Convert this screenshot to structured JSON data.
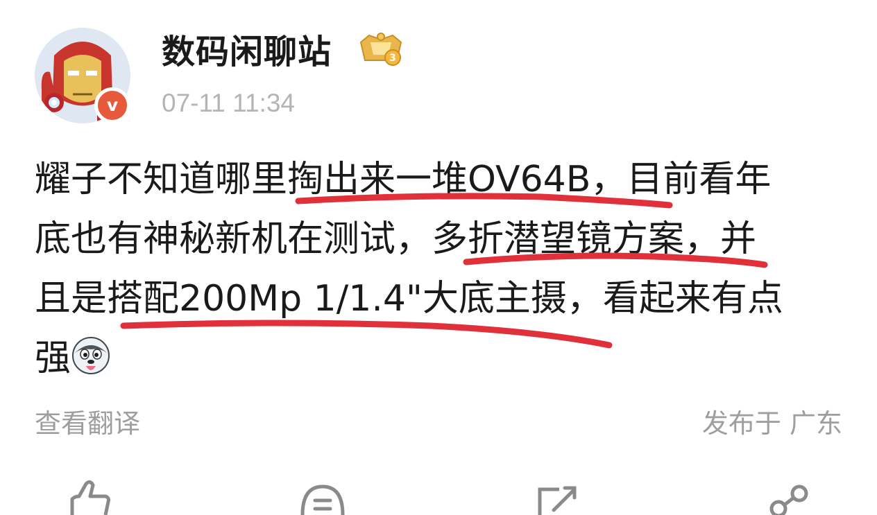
{
  "author": {
    "name": "数码闲聊站",
    "verified_mark": "v",
    "vip_level": "3",
    "timestamp": "07-11 11:34"
  },
  "post": {
    "lines": [
      "耀子不知道哪里掏出来一堆OV64B，目前看年",
      "底也有神秘新机在测试，多折潜望镜方案，并",
      "且是搭配200Mp 1/1.4\"大底主摄，看起来有点",
      "强"
    ],
    "emoji": "husky-tongue-emoji",
    "underline_color": "#e0303a"
  },
  "footer": {
    "translate_label": "查看翻译",
    "location_label": "发布于 广东"
  },
  "actions": {
    "icons": [
      "like-icon",
      "comment-icon",
      "repost-icon",
      "share-icon"
    ]
  },
  "colors": {
    "text": "#1a1a1a",
    "muted": "#9e9e9e",
    "timestamp": "#b4b4b4",
    "verify_badge": "#e7593b",
    "vip_gold": "#e8b64a"
  }
}
